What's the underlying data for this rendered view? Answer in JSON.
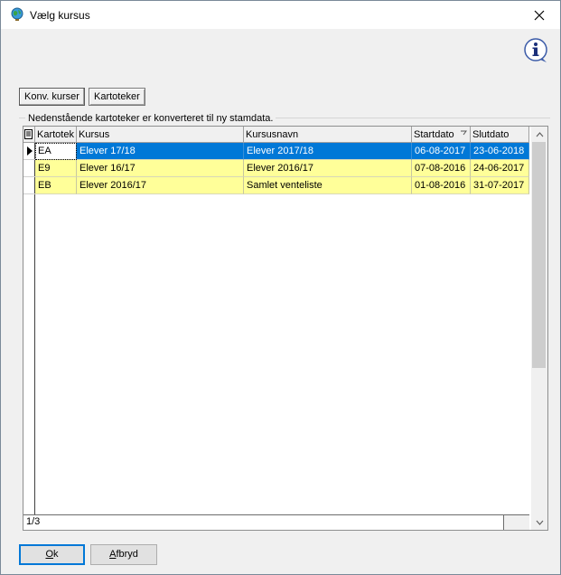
{
  "window": {
    "title": "Vælg kursus",
    "close_glyph": "✕"
  },
  "tabs": [
    {
      "label": "Konv. kurser",
      "active": true
    },
    {
      "label": "Kartoteker",
      "active": false
    }
  ],
  "caption": "Nedenstående kartoteker er konverteret til ny stamdata.",
  "grid": {
    "columns": [
      "",
      "Kartotek",
      "Kursus",
      "Kursusnavn",
      "Startdato",
      "Slutdato"
    ],
    "sort_column": "Startdato",
    "rows": [
      {
        "kartotek": "EA",
        "kursus": "Elever 17/18",
        "kursusnavn": "Elever 2017/18",
        "startdato": "06-08-2017",
        "slutdato": "23-06-2018",
        "selected": true
      },
      {
        "kartotek": "E9",
        "kursus": "Elever 16/17",
        "kursusnavn": "Elever 2016/17",
        "startdato": "07-08-2016",
        "slutdato": "24-06-2017",
        "selected": false
      },
      {
        "kartotek": "EB",
        "kursus": "Elever 2016/17",
        "kursusnavn": "Samlet venteliste",
        "startdato": "01-08-2016",
        "slutdato": "31-07-2017",
        "selected": false
      }
    ],
    "status": "1/3"
  },
  "buttons": {
    "ok": {
      "pre": "",
      "ul": "O",
      "post": "k"
    },
    "cancel": {
      "pre": "",
      "ul": "A",
      "post": "fbryd"
    }
  },
  "colors": {
    "selection": "#0078d7",
    "row_highlight": "#ffff99",
    "accent": "#0078d7"
  },
  "icons": [
    "globe-app-icon",
    "close-icon",
    "info-icon",
    "row-pointer-icon",
    "sort-indicator-icon",
    "scroll-up-icon",
    "scroll-down-icon"
  ]
}
